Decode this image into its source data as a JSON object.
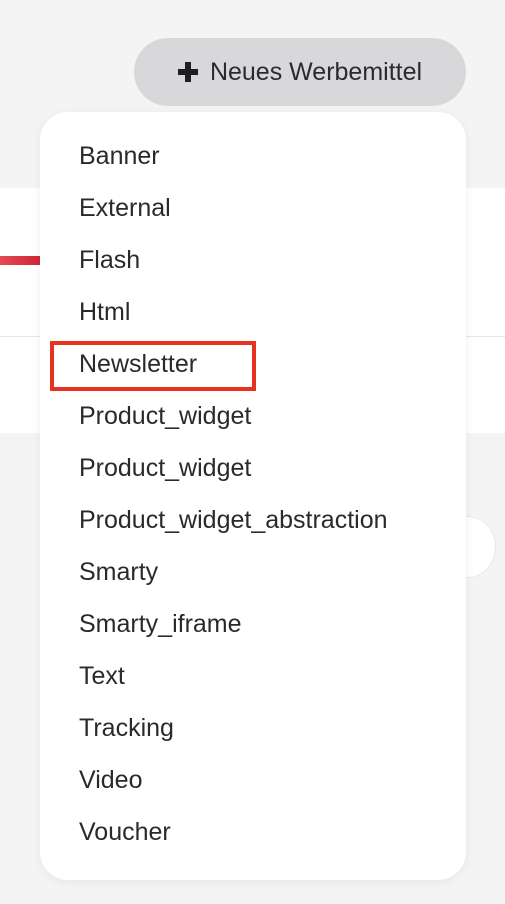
{
  "toolbar": {
    "new_button_label": "Neues Werbemittel",
    "new_button_icon": "plus-icon"
  },
  "dropdown": {
    "items": [
      {
        "label": "Banner"
      },
      {
        "label": "External"
      },
      {
        "label": "Flash"
      },
      {
        "label": "Html"
      },
      {
        "label": "Newsletter",
        "highlighted": true
      },
      {
        "label": "Product_widget"
      },
      {
        "label": "Product_widget"
      },
      {
        "label": "Product_widget_abstraction"
      },
      {
        "label": "Smarty"
      },
      {
        "label": "Smarty_iframe"
      },
      {
        "label": "Text"
      },
      {
        "label": "Tracking"
      },
      {
        "label": "Video"
      },
      {
        "label": "Voucher"
      }
    ]
  },
  "colors": {
    "highlight": "#e8321f",
    "button_bg": "#d8d8da",
    "accent": "#c8202d"
  }
}
